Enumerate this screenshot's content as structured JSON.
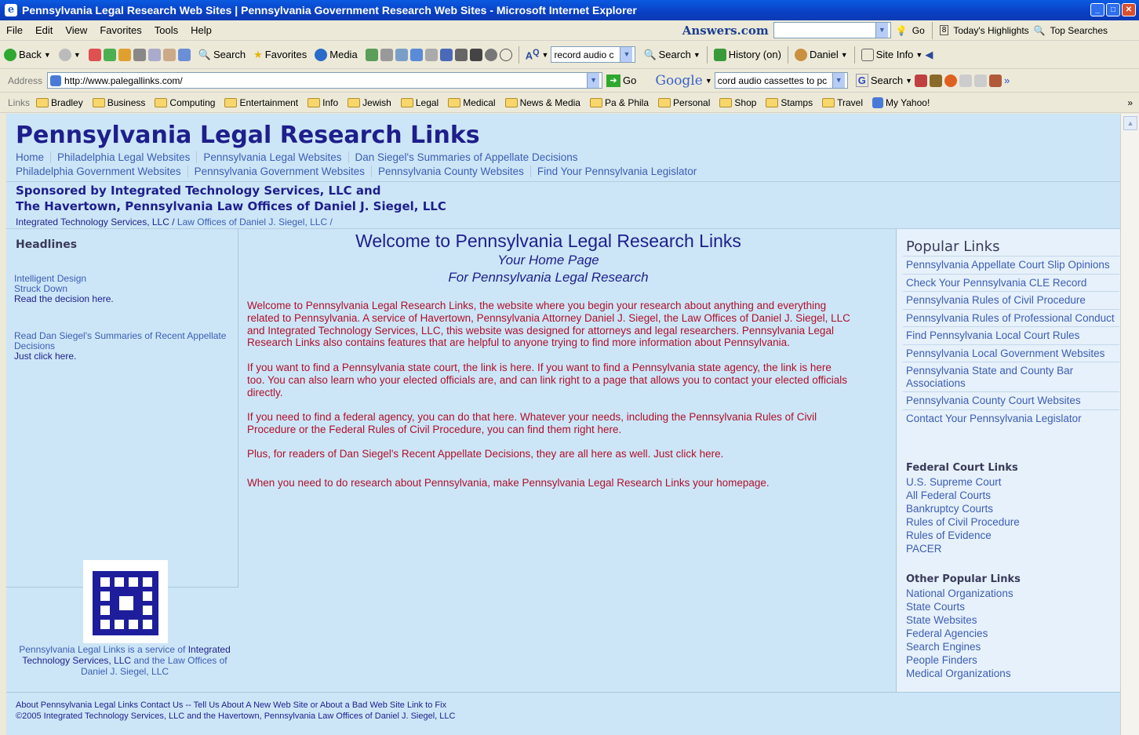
{
  "window": {
    "title": "Pennsylvania Legal Research Web Sites | Pennsylvania Government Research Web Sites - Microsoft Internet Explorer"
  },
  "menu": [
    "File",
    "Edit",
    "View",
    "Favorites",
    "Tools",
    "Help"
  ],
  "answers": {
    "label": "Answers.com",
    "go": "Go",
    "highlights": "Today's Highlights",
    "top_searches": "Top Searches"
  },
  "toolbar": {
    "back": "Back",
    "search": "Search",
    "favorites": "Favorites",
    "media": "Media",
    "ask_value": "record audio c",
    "search2": "Search",
    "history": "History (on)",
    "user": "Daniel",
    "site_info": "Site Info"
  },
  "address": {
    "label": "Address",
    "url": "http://www.palegallinks.com/",
    "go": "Go",
    "google": "Google",
    "google_query": "cord audio cassettes to pc",
    "search": "Search"
  },
  "links": {
    "label": "Links",
    "items": [
      "Bradley",
      "Business",
      "Computing",
      "Entertainment",
      "Info",
      "Jewish",
      "Legal",
      "Medical",
      "News & Media",
      "Pa & Phila",
      "Personal",
      "Shop",
      "Stamps",
      "Travel",
      "My Yahoo!"
    ]
  },
  "site": {
    "title": "Pennsylvania Legal Research Links",
    "nav1": [
      "Home",
      "Philadelphia Legal Websites",
      "Pennsylvania Legal Websites",
      "Dan Siegel's Summaries of Appellate Decisions"
    ],
    "nav2": [
      "Philadelphia Government Websites",
      "Pennsylvania Government Websites",
      "Pennsylvania County Websites",
      "Find Your Pennsylvania Legislator"
    ],
    "sponsor1": "Sponsored by Integrated Technology Services, LLC and",
    "sponsor2": "The Havertown, Pennsylvania Law Offices of Daniel J. Siegel, LLC",
    "crumb_a": "Integrated Technology Services, LLC",
    "crumb_b": " / ",
    "crumb_c": "Law Offices of Daniel J. Siegel, LLC /"
  },
  "left": {
    "heading": "Headlines",
    "h1a": "Intelligent Design",
    "h1b": "Struck Down",
    "h1c": "Read the decision here.",
    "h2a": "Read Dan Siegel's Summaries of Recent Appellate",
    "h2b": "Decisions",
    "h2c": "Just click here.",
    "cap1": "Pennsylvania Legal Links is a service of ",
    "cap2": "Integrated Technology Services, LLC",
    "cap3": " and the Law Offices of Daniel J. Siegel, LLC"
  },
  "center": {
    "welcome": "Welcome to Pennsylvania Legal Research Links",
    "sub1": "Your Home Page",
    "sub2": "For Pennsylvania Legal Research",
    "p1": "Welcome to Pennsylvania Legal Research Links, the website where you begin your research about anything and everything related to Pennsylvania. A service of Havertown, Pennsylvania Attorney Daniel J. Siegel, the Law Offices of Daniel J. Siegel, LLC and Integrated Technology Services, LLC, this website was designed for attorneys and legal researchers. Pennsylvania Legal Research Links also contains features that are helpful to anyone trying to find more information about Pennsylvania.",
    "p2": "If you want to find a Pennsylvania state court, the link is here. If you want to find a Pennsylvania state agency, the link is here too. You can also learn who your elected officials are, and can link right to a page that allows you to contact your elected officials directly.",
    "p3": "If you need to find a federal agency, you can do that here. Whatever your needs, including the Pennsylvania Rules of Civil Procedure or the Federal Rules of Civil Procedure, you can find them right here.",
    "p4": "Plus, for readers of Dan Siegel's Recent Appellate Decisions, they are all here as well. Just click here.",
    "p5": "When you need to do research about Pennsylvania, make Pennsylvania Legal Research Links your homepage."
  },
  "right": {
    "popular_heading": "Popular Links",
    "popular": [
      "Pennsylvania Appellate Court Slip Opinions",
      "Check Your Pennsylvania CLE Record",
      "Pennsylvania Rules of Civil Procedure",
      "Pennsylvania Rules of Professional Conduct",
      "Find Pennsylvania Local Court Rules",
      "Pennsylvania Local Government Websites",
      "Pennsylvania State and County Bar Associations",
      "Pennsylvania County Court Websites",
      "Contact Your Pennsylvania Legislator"
    ],
    "federal_heading": "Federal Court Links",
    "federal": [
      "U.S. Supreme Court",
      "All Federal Courts",
      "Bankruptcy Courts",
      "Rules of Civil Procedure",
      "Rules of Evidence",
      "PACER"
    ],
    "other_heading": "Other Popular Links",
    "other": [
      "National Organizations",
      "State Courts",
      "State Websites",
      "Federal Agencies",
      "Search Engines",
      "People Finders",
      "Medical Organizations"
    ]
  },
  "footer": {
    "line1": "About Pennsylvania Legal Links  Contact Us -- Tell Us About A New Web Site or About a Bad Web Site Link to Fix",
    "line2": "©2005 Integrated Technology Services, LLC and the Havertown, Pennsylvania Law Offices of Daniel J. Siegel, LLC"
  },
  "colors": {
    "title_blue": "#1e1e8c",
    "link_blue": "#3c5db4",
    "body_red": "#b0102b",
    "page_bg": "#cce6f7"
  }
}
